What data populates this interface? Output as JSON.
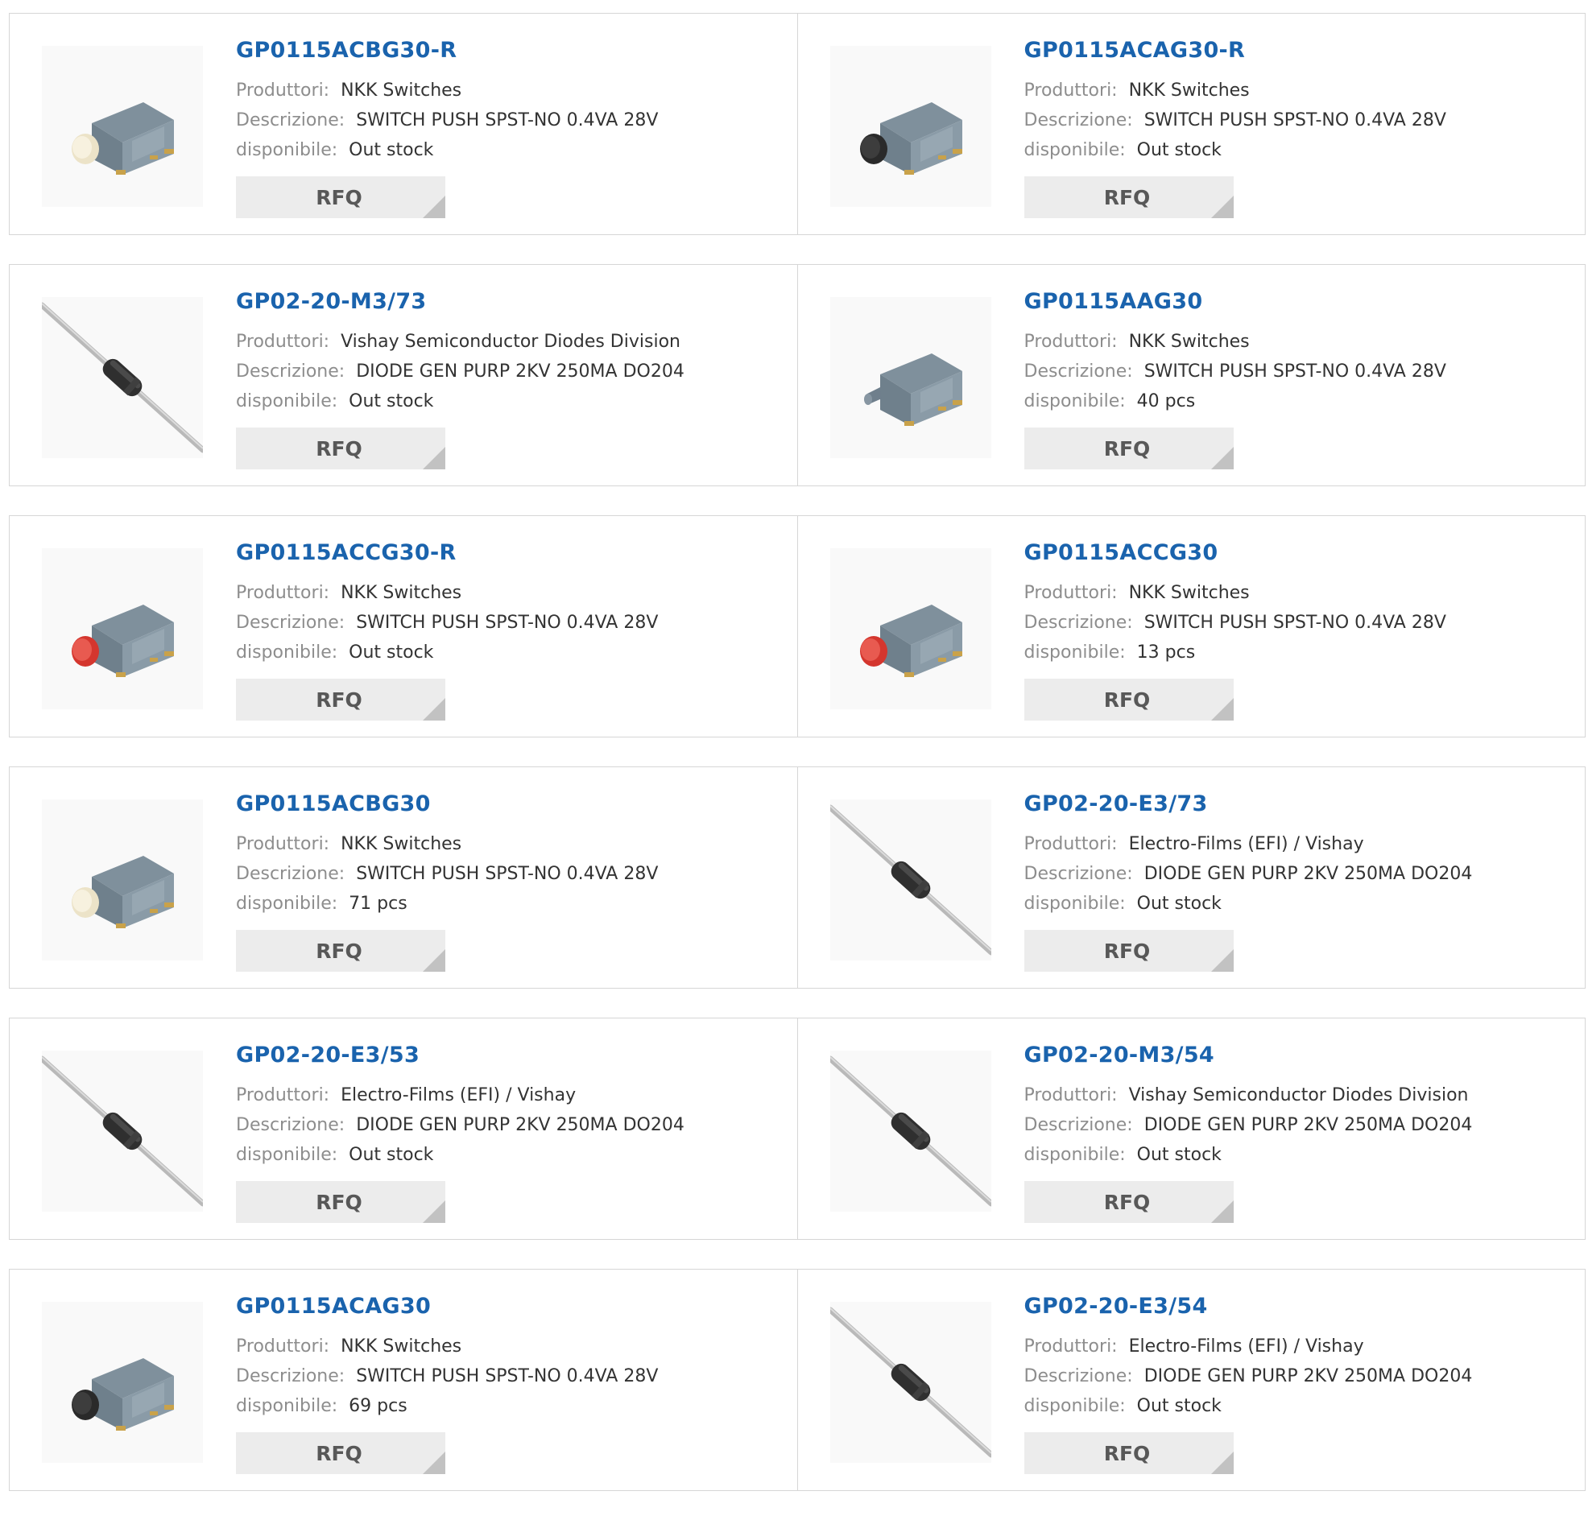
{
  "labels": {
    "producer": "Produttori:",
    "description": "Descrizione:",
    "availability": "disponibile:",
    "rfq": "RFQ"
  },
  "products": [
    {
      "part": "GP0115ACBG30-R",
      "producer": "NKK Switches",
      "description": "SWITCH PUSH SPST-NO 0.4VA 28V",
      "availability": "Out stock",
      "image": "switch-cream"
    },
    {
      "part": "GP0115ACAG30-R",
      "producer": "NKK Switches",
      "description": "SWITCH PUSH SPST-NO 0.4VA 28V",
      "availability": "Out stock",
      "image": "switch-black"
    },
    {
      "part": "GP02-20-M3/73",
      "producer": "Vishay Semiconductor Diodes Division",
      "description": "DIODE GEN PURP 2KV 250MA DO204",
      "availability": "Out stock",
      "image": "diode"
    },
    {
      "part": "GP0115AAG30",
      "producer": "NKK Switches",
      "description": "SWITCH PUSH SPST-NO 0.4VA 28V",
      "availability": "40 pcs",
      "image": "switch-plunger"
    },
    {
      "part": "GP0115ACCG30-R",
      "producer": "NKK Switches",
      "description": "SWITCH PUSH SPST-NO 0.4VA 28V",
      "availability": "Out stock",
      "image": "switch-red"
    },
    {
      "part": "GP0115ACCG30",
      "producer": "NKK Switches",
      "description": "SWITCH PUSH SPST-NO 0.4VA 28V",
      "availability": "13 pcs",
      "image": "switch-red"
    },
    {
      "part": "GP0115ACBG30",
      "producer": "NKK Switches",
      "description": "SWITCH PUSH SPST-NO 0.4VA 28V",
      "availability": "71 pcs",
      "image": "switch-cream"
    },
    {
      "part": "GP02-20-E3/73",
      "producer": "Electro-Films (EFI) / Vishay",
      "description": "DIODE GEN PURP 2KV 250MA DO204",
      "availability": "Out stock",
      "image": "diode"
    },
    {
      "part": "GP02-20-E3/53",
      "producer": "Electro-Films (EFI) / Vishay",
      "description": "DIODE GEN PURP 2KV 250MA DO204",
      "availability": "Out stock",
      "image": "diode"
    },
    {
      "part": "GP02-20-M3/54",
      "producer": "Vishay Semiconductor Diodes Division",
      "description": "DIODE GEN PURP 2KV 250MA DO204",
      "availability": "Out stock",
      "image": "diode"
    },
    {
      "part": "GP0115ACAG30",
      "producer": "NKK Switches",
      "description": "SWITCH PUSH SPST-NO 0.4VA 28V",
      "availability": "69 pcs",
      "image": "switch-black"
    },
    {
      "part": "GP02-20-E3/54",
      "producer": "Electro-Films (EFI) / Vishay",
      "description": "DIODE GEN PURP 2KV 250MA DO204",
      "availability": "Out stock",
      "image": "diode"
    }
  ],
  "colors": {
    "title": "#1a63ad",
    "label": "#8d8d8d",
    "value": "#333333",
    "button_bg": "#ececec",
    "button_corner": "#c2c2c2",
    "border": "#d6d6d6"
  }
}
